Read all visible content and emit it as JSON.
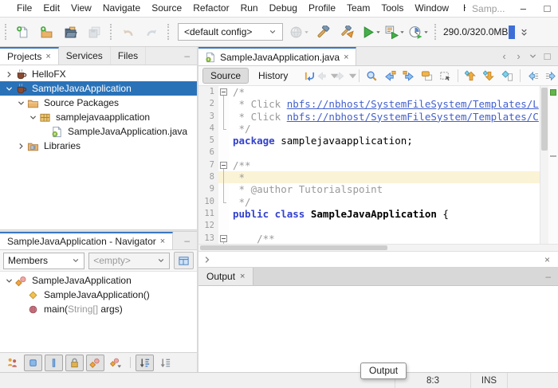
{
  "glyphs": {
    "close": "×",
    "minimize": "–",
    "maximize": "□",
    "back": "‹",
    "forward": "›"
  },
  "titlebar": {
    "menus": [
      "File",
      "Edit",
      "View",
      "Navigate",
      "Source",
      "Refactor",
      "Run",
      "Debug",
      "Profile",
      "Team",
      "Tools",
      "Window",
      "Help"
    ],
    "window_title": "Samp..."
  },
  "toolbar": {
    "groups": [
      {
        "items": [
          {
            "name": "new-file"
          },
          {
            "name": "new-project"
          },
          {
            "name": "open-project"
          },
          {
            "name": "save-all",
            "disabled": true
          }
        ]
      },
      {
        "items": [
          {
            "name": "undo",
            "disabled": true
          },
          {
            "name": "redo",
            "disabled": true
          }
        ]
      },
      {
        "items": [
          {
            "name": "config-combo",
            "type": "combo",
            "value": "<default config>"
          },
          {
            "name": "web-browser",
            "disabled": true,
            "dropdown": true
          },
          {
            "name": "build-project"
          },
          {
            "name": "clean-build-project"
          },
          {
            "name": "run-project",
            "dropdown": true
          },
          {
            "name": "debug-project",
            "dropdown": true
          },
          {
            "name": "profile-project",
            "dropdown": true
          }
        ]
      },
      {
        "items": [
          {
            "name": "memory-indicator",
            "type": "memory",
            "value": "290.0/320.0MB"
          }
        ]
      }
    ]
  },
  "left": {
    "tabs": [
      {
        "label": "Projects",
        "active": true,
        "closable": true
      },
      {
        "label": "Services"
      },
      {
        "label": "Files"
      }
    ],
    "projects_tree": [
      {
        "label": "HelloFX",
        "icon": "java-project",
        "expand": "collapsed",
        "indent": 0
      },
      {
        "label": "SampleJavaApplication",
        "icon": "java-project",
        "expand": "expanded",
        "indent": 0,
        "selected": true
      },
      {
        "label": "Source Packages",
        "icon": "source-folder",
        "expand": "expanded",
        "indent": 1
      },
      {
        "label": "samplejavaapplication",
        "icon": "package",
        "expand": "expanded",
        "indent": 2
      },
      {
        "label": "SampleJavaApplication.java",
        "icon": "java-file",
        "indent": 3
      },
      {
        "label": "Libraries",
        "icon": "libraries-folder",
        "expand": "collapsed",
        "indent": 1
      }
    ],
    "navigator": {
      "tab": "SampleJavaApplication - Navigator",
      "members_combo": "Members",
      "empty_combo": "<empty>",
      "tree": [
        {
          "label": "SampleJavaApplication",
          "icon": "class",
          "expand": "expanded",
          "indent": 0
        },
        {
          "label": "SampleJavaApplication()",
          "icon": "constructor",
          "indent": 1
        },
        {
          "parts": [
            {
              "t": "main(",
              "c": "plain"
            },
            {
              "t": "String[]",
              "c": "dim"
            },
            {
              "t": " args)",
              "c": "plain"
            }
          ],
          "icon": "static-method",
          "indent": 1
        }
      ],
      "filters": [
        {
          "name": "show-inherited-members"
        },
        {
          "name": "show-fields",
          "pressed": true
        },
        {
          "name": "show-static-members",
          "pressed": true
        },
        {
          "name": "show-non-public-members",
          "pressed": true
        },
        {
          "name": "show-inner-classes",
          "pressed": true
        },
        {
          "name": "filters-dropdown"
        },
        {
          "sep": true
        },
        {
          "name": "sort-by-name",
          "pressed": true
        },
        {
          "name": "sort-by-source"
        }
      ]
    }
  },
  "editor": {
    "tab": "SampleJavaApplication.java",
    "source_btn": "Source",
    "history_btn": "History",
    "toolbar": [
      {
        "name": "last-edit-position"
      },
      {
        "name": "back",
        "disabled": true,
        "dropdown": true
      },
      {
        "name": "forward",
        "disabled": true,
        "dropdown": true
      },
      {
        "sep": true
      },
      {
        "name": "find-selection"
      },
      {
        "name": "find-previous-occurrence"
      },
      {
        "name": "find-next-occurrence"
      },
      {
        "name": "toggle-highlight-search"
      },
      {
        "name": "rectangular-selection"
      },
      {
        "sep": true
      },
      {
        "name": "previous-bookmark"
      },
      {
        "name": "next-bookmark"
      },
      {
        "name": "toggle-bookmark"
      },
      {
        "sep": true
      },
      {
        "name": "shift-left"
      },
      {
        "name": "shift-right"
      },
      {
        "name": "editor-overflow"
      }
    ],
    "lines": [
      {
        "n": 1,
        "fold": "box",
        "segs": [
          {
            "t": "/*",
            "c": "comment"
          }
        ]
      },
      {
        "n": 2,
        "fold": "line",
        "segs": [
          {
            "t": " * Click ",
            "c": "comment"
          },
          {
            "t": "nbfs://nbhost/SystemFileSystem/Templates/L",
            "c": "link"
          }
        ]
      },
      {
        "n": 3,
        "fold": "line",
        "segs": [
          {
            "t": " * Click ",
            "c": "comment"
          },
          {
            "t": "nbfs://nbhost/SystemFileSystem/Templates/C",
            "c": "link"
          }
        ]
      },
      {
        "n": 4,
        "fold": "corner",
        "segs": [
          {
            "t": " */",
            "c": "comment"
          }
        ]
      },
      {
        "n": 5,
        "segs": [
          {
            "t": "package",
            "c": "keyword"
          },
          {
            "t": " samplejavaapplication;",
            "c": "plain"
          }
        ]
      },
      {
        "n": 6,
        "segs": []
      },
      {
        "n": 7,
        "fold": "box",
        "segs": [
          {
            "t": "/**",
            "c": "comment"
          }
        ]
      },
      {
        "n": 8,
        "fold": "line",
        "highlight": true,
        "segs": [
          {
            "t": " *",
            "c": "comment"
          }
        ]
      },
      {
        "n": 9,
        "fold": "line",
        "segs": [
          {
            "t": " * @author Tutorialspoint",
            "c": "comment"
          }
        ]
      },
      {
        "n": 10,
        "fold": "corner",
        "segs": [
          {
            "t": " */",
            "c": "comment"
          }
        ]
      },
      {
        "n": 11,
        "segs": [
          {
            "t": "public class",
            "c": "keyword"
          },
          {
            "t": " ",
            "c": "plain"
          },
          {
            "t": "SampleJavaApplication",
            "c": "class"
          },
          {
            "t": " {",
            "c": "plain"
          }
        ]
      },
      {
        "n": 12,
        "segs": []
      },
      {
        "n": 13,
        "fold": "box",
        "segs": [
          {
            "t": "    /**",
            "c": "comment"
          }
        ]
      }
    ]
  },
  "output": {
    "tab": "Output"
  },
  "statusbar": {
    "caret": "8:3",
    "mode": "INS"
  },
  "tooltip": {
    "text": "Output"
  }
}
